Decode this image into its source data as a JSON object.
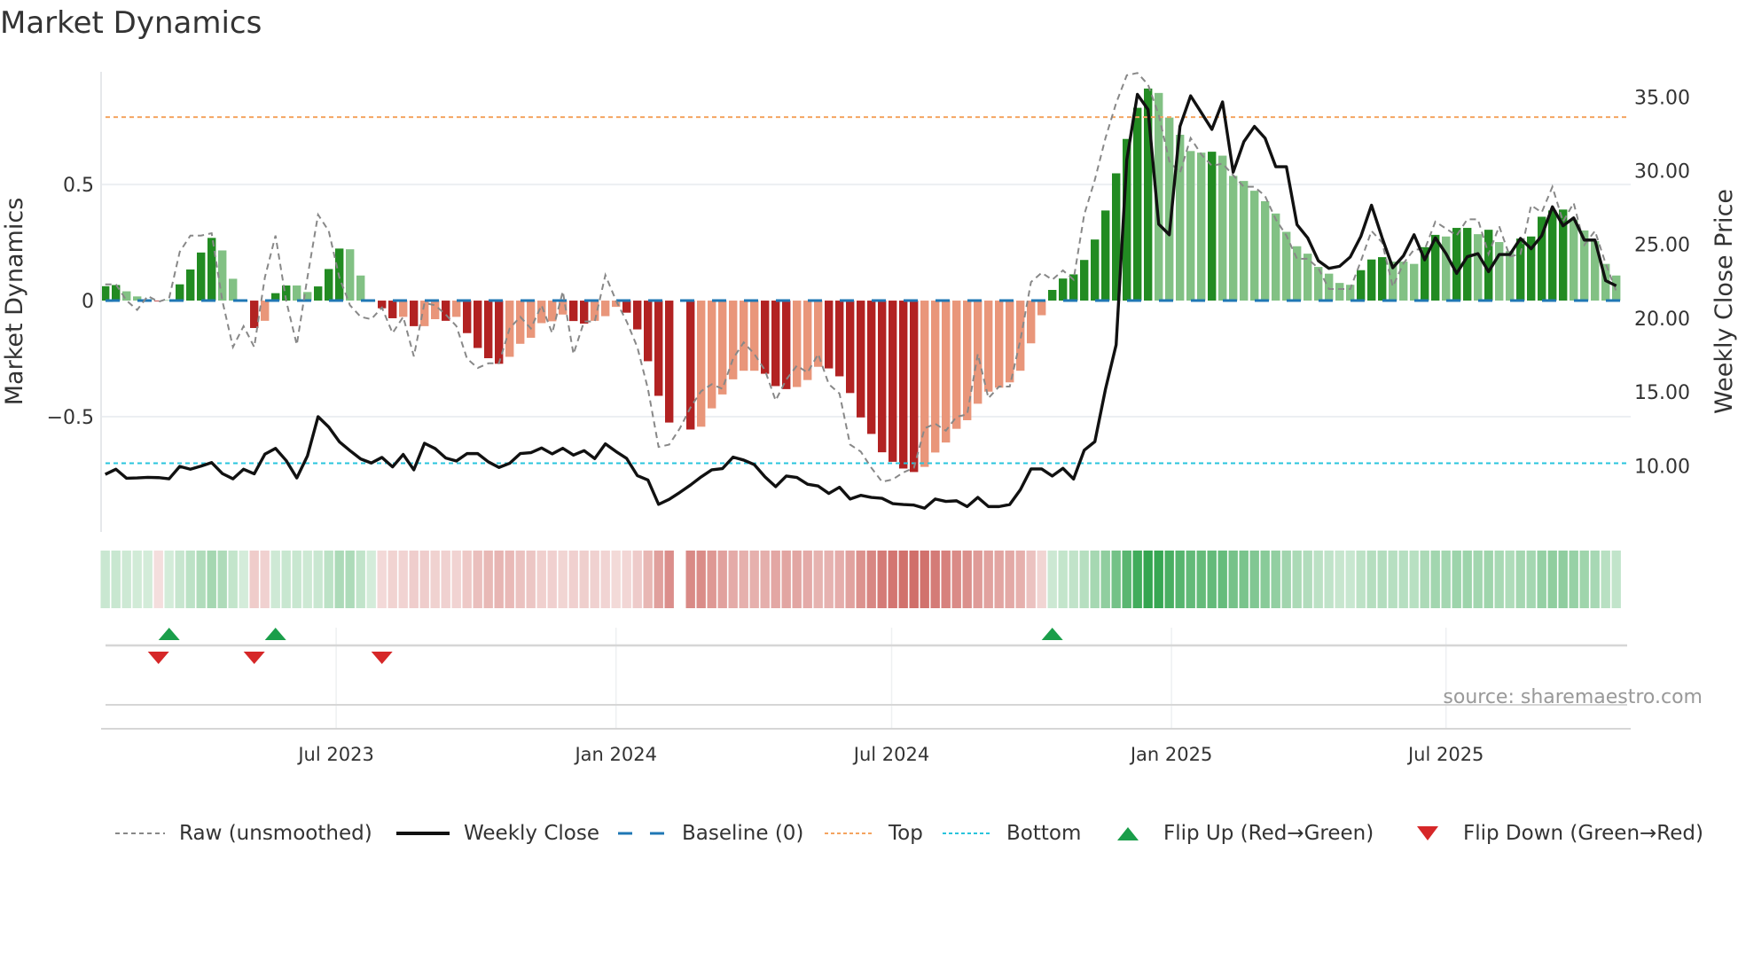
{
  "title": "Market Dynamics",
  "source": "source: sharemaestro.com",
  "colors": {
    "strong_green": "#228b22",
    "weak_green": "#82c184",
    "strong_red": "#b22222",
    "weak_red": "#e9967a",
    "raw": "#888888",
    "close": "#111111",
    "baseline": "#1f77b4",
    "top": "#f4a460",
    "bottom": "#29c4dc",
    "flip_up": "#1a9e4a",
    "flip_down": "#d62728"
  },
  "legend": [
    {
      "key": "raw",
      "label": "Raw (unsmoothed)"
    },
    {
      "key": "close",
      "label": "Weekly Close"
    },
    {
      "key": "baseline",
      "label": "Baseline (0)"
    },
    {
      "key": "top",
      "label": "Top"
    },
    {
      "key": "bottom",
      "label": "Bottom"
    },
    {
      "key": "flip_up",
      "label": "Flip Up (Red→Green)"
    },
    {
      "key": "flip_down",
      "label": "Flip Down (Green→Red)"
    }
  ],
  "chart_data": {
    "type": "bar",
    "title": "Market Dynamics",
    "ylabel": "Market Dynamics",
    "y2label": "Weekly Close Price",
    "ylim": [
      -0.996,
      0.985
    ],
    "y2lim": [
      5.52,
      36.7
    ],
    "yticks": [
      {
        "v": -0.5,
        "label": "−0.5"
      },
      {
        "v": 0,
        "label": "0"
      },
      {
        "v": 0.5,
        "label": "0.5"
      }
    ],
    "y2ticks": [
      {
        "v": 10,
        "label": "10.00"
      },
      {
        "v": 15,
        "label": "15.00"
      },
      {
        "v": 20,
        "label": "20.00"
      },
      {
        "v": 25,
        "label": "25.00"
      },
      {
        "v": 30,
        "label": "30.00"
      },
      {
        "v": 35,
        "label": "35.00"
      }
    ],
    "xticks": [
      {
        "week": 21.7,
        "label": "Jul 2023"
      },
      {
        "week": 48.0,
        "label": "Jan 2024"
      },
      {
        "week": 73.9,
        "label": "Jul 2024"
      },
      {
        "week": 100.2,
        "label": "Jan 2025"
      },
      {
        "week": 126.0,
        "label": "Jul 2025"
      }
    ],
    "grid": true,
    "legend_position": "bottom",
    "top_level": 0.79,
    "bottom_level": -0.7,
    "baseline": 0,
    "momentum": [
      0.062,
      0.067,
      0.04,
      0.018,
      0.006,
      -0.003,
      0.002,
      0.07,
      0.134,
      0.207,
      0.27,
      0.216,
      0.094,
      0.0,
      -0.118,
      -0.087,
      0.032,
      0.065,
      0.065,
      0.037,
      0.061,
      0.136,
      0.224,
      0.221,
      0.108,
      0.0,
      -0.033,
      -0.076,
      -0.07,
      -0.11,
      -0.11,
      -0.08,
      -0.087,
      -0.07,
      -0.14,
      -0.204,
      -0.248,
      -0.272,
      -0.242,
      -0.186,
      -0.16,
      -0.097,
      -0.089,
      -0.06,
      -0.088,
      -0.099,
      -0.087,
      -0.067,
      -0.027,
      -0.052,
      -0.124,
      -0.261,
      -0.41,
      -0.525,
      null,
      -0.555,
      -0.543,
      -0.464,
      -0.404,
      -0.339,
      -0.302,
      -0.302,
      -0.315,
      -0.368,
      -0.381,
      -0.372,
      -0.342,
      -0.285,
      -0.292,
      -0.326,
      -0.398,
      -0.503,
      -0.574,
      -0.653,
      -0.694,
      -0.723,
      -0.738,
      -0.716,
      -0.654,
      -0.611,
      -0.552,
      -0.515,
      -0.444,
      -0.392,
      -0.375,
      -0.352,
      -0.302,
      -0.184,
      -0.063,
      0.046,
      0.095,
      0.113,
      0.175,
      0.263,
      0.388,
      0.548,
      0.696,
      0.83,
      0.913,
      0.894,
      0.788,
      0.714,
      0.644,
      0.637,
      0.641,
      0.624,
      0.537,
      0.515,
      0.473,
      0.428,
      0.375,
      0.296,
      0.234,
      0.202,
      0.145,
      0.116,
      0.076,
      0.068,
      0.131,
      0.177,
      0.187,
      0.168,
      0.168,
      0.158,
      0.23,
      0.283,
      0.276,
      0.313,
      0.313,
      0.286,
      0.305,
      0.252,
      0.213,
      0.267,
      0.276,
      0.361,
      0.388,
      0.392,
      0.348,
      0.302,
      0.256,
      0.158,
      0.108
    ],
    "strong": [
      1,
      1,
      0,
      0,
      0,
      1,
      0,
      1,
      1,
      1,
      1,
      0,
      0,
      0,
      1,
      0,
      1,
      1,
      0,
      0,
      1,
      1,
      1,
      0,
      0,
      0,
      1,
      1,
      0,
      1,
      0,
      0,
      1,
      0,
      1,
      1,
      1,
      1,
      0,
      0,
      0,
      0,
      0,
      0,
      1,
      1,
      0,
      0,
      0,
      1,
      1,
      1,
      1,
      1,
      0,
      1,
      0,
      0,
      0,
      0,
      0,
      0,
      1,
      1,
      1,
      0,
      0,
      0,
      1,
      1,
      1,
      1,
      1,
      1,
      1,
      1,
      1,
      0,
      0,
      0,
      0,
      0,
      0,
      0,
      0,
      0,
      0,
      0,
      0,
      1,
      1,
      1,
      1,
      1,
      1,
      1,
      1,
      1,
      1,
      0,
      0,
      0,
      0,
      0,
      1,
      0,
      0,
      0,
      0,
      0,
      0,
      0,
      0,
      0,
      0,
      0,
      0,
      0,
      1,
      1,
      1,
      0,
      0,
      0,
      1,
      1,
      0,
      1,
      1,
      0,
      1,
      0,
      0,
      1,
      1,
      1,
      1,
      1,
      0,
      0,
      0,
      0,
      0
    ],
    "raw": [
      0.07,
      0.07,
      0.0,
      -0.04,
      0.02,
      -0.005,
      0.01,
      0.21,
      0.28,
      0.28,
      0.29,
      0.0,
      -0.2,
      -0.11,
      -0.2,
      0.1,
      0.28,
      0.0,
      -0.19,
      0.1,
      0.37,
      0.3,
      0.1,
      -0.02,
      -0.07,
      -0.08,
      -0.03,
      -0.14,
      -0.07,
      -0.24,
      -0.01,
      -0.02,
      -0.06,
      -0.11,
      -0.25,
      -0.29,
      -0.27,
      -0.27,
      -0.12,
      -0.07,
      -0.12,
      -0.02,
      -0.14,
      0.04,
      -0.23,
      -0.09,
      -0.09,
      0.11,
      0.0,
      -0.09,
      -0.2,
      -0.38,
      -0.63,
      -0.62,
      -0.55,
      -0.46,
      -0.39,
      -0.36,
      -0.38,
      -0.25,
      -0.18,
      -0.23,
      -0.3,
      -0.43,
      -0.34,
      -0.28,
      -0.31,
      -0.23,
      -0.36,
      -0.4,
      -0.62,
      -0.65,
      -0.72,
      -0.78,
      -0.77,
      -0.74,
      -0.72,
      -0.55,
      -0.53,
      -0.56,
      -0.5,
      -0.49,
      -0.23,
      -0.42,
      -0.37,
      -0.37,
      -0.17,
      0.08,
      0.12,
      0.09,
      0.13,
      0.09,
      0.37,
      0.52,
      0.7,
      0.85,
      0.97,
      0.98,
      0.93,
      0.8,
      0.6,
      0.55,
      0.7,
      0.63,
      0.58,
      0.59,
      0.54,
      0.49,
      0.49,
      0.45,
      0.35,
      0.28,
      0.18,
      0.18,
      0.14,
      0.05,
      0.05,
      0.05,
      0.17,
      0.3,
      0.25,
      0.06,
      0.16,
      0.22,
      0.22,
      0.34,
      0.31,
      0.28,
      0.35,
      0.35,
      0.2,
      0.32,
      0.19,
      0.2,
      0.41,
      0.38,
      0.49,
      0.34,
      0.42,
      0.24,
      0.3,
      0.16,
      0.04
    ],
    "close": [
      9.42,
      9.77,
      9.16,
      9.18,
      9.22,
      9.2,
      9.12,
      9.96,
      9.77,
      9.98,
      10.22,
      9.48,
      9.12,
      9.77,
      9.46,
      10.79,
      11.18,
      10.36,
      9.18,
      10.67,
      13.33,
      12.63,
      11.63,
      11.03,
      10.47,
      10.19,
      10.57,
      9.93,
      10.77,
      9.73,
      11.53,
      11.17,
      10.53,
      10.33,
      10.83,
      10.83,
      10.27,
      9.89,
      10.17,
      10.83,
      10.89,
      11.21,
      10.81,
      11.19,
      10.73,
      11.03,
      10.49,
      11.49,
      10.97,
      10.5,
      9.34,
      9.04,
      7.39,
      7.73,
      8.2,
      8.7,
      9.25,
      9.73,
      9.81,
      10.59,
      10.39,
      10.08,
      9.25,
      8.59,
      9.31,
      9.21,
      8.75,
      8.63,
      8.13,
      8.55,
      7.75,
      8.0,
      7.86,
      7.8,
      7.44,
      7.38,
      7.34,
      7.13,
      7.75,
      7.59,
      7.63,
      7.24,
      7.86,
      7.24,
      7.24,
      7.38,
      8.38,
      9.79,
      9.79,
      9.31,
      9.83,
      9.11,
      11.06,
      11.64,
      15.2,
      18.2,
      30.73,
      35.17,
      34.14,
      26.38,
      25.66,
      33.0,
      35.07,
      33.94,
      32.8,
      34.66,
      29.9,
      31.96,
      33.0,
      32.2,
      30.27,
      30.27,
      26.34,
      25.45,
      23.9,
      23.38,
      23.52,
      24.15,
      25.55,
      27.66,
      25.45,
      23.42,
      24.23,
      25.66,
      23.96,
      25.45,
      24.38,
      23.04,
      24.17,
      24.38,
      23.16,
      24.32,
      24.32,
      25.41,
      24.71,
      25.6,
      27.55,
      26.27,
      26.8,
      25.3,
      25.3,
      22.55,
      22.2
    ],
    "flip_up_weeks": [
      6,
      16,
      89
    ],
    "flip_down_weeks": [
      5,
      14,
      26
    ]
  }
}
